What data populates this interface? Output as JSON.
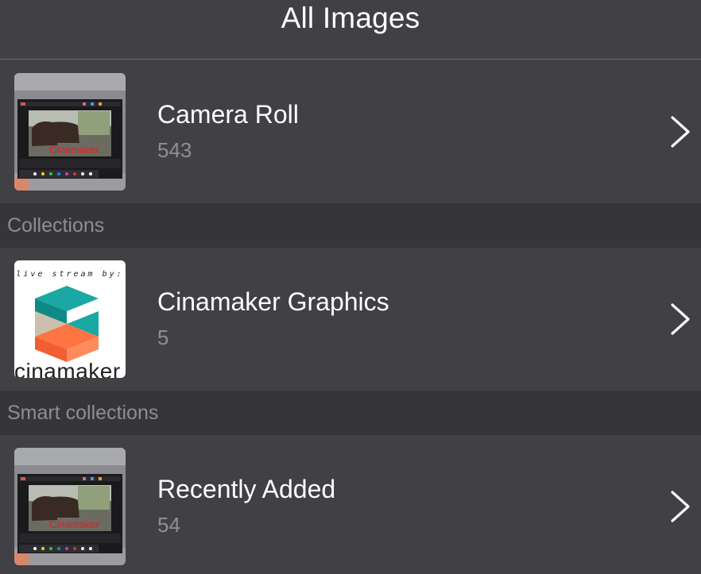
{
  "nav": {
    "title": "All Images"
  },
  "rows": {
    "camera_roll": {
      "title": "Camera Roll",
      "count": "543"
    },
    "cinamaker_graphics": {
      "title": "Cinamaker Graphics",
      "count": "5",
      "thumb_tagline": "live stream by:",
      "thumb_brand": "cinamaker"
    },
    "recently_added": {
      "title": "Recently Added",
      "count": "54"
    }
  },
  "sections": {
    "collections": "Collections",
    "smart_collections": "Smart collections"
  },
  "thumb_watermark": "Cinamaker",
  "icons": {
    "chevron": "chevron-right-icon"
  },
  "colors": {
    "background": "#404045",
    "section_header": "#36363a",
    "title_text": "#ffffff",
    "secondary_text": "#8e8e94",
    "logo_teal": "#19aaa6",
    "logo_orange": "#ff7443",
    "logo_beige": "#cdbfad"
  }
}
